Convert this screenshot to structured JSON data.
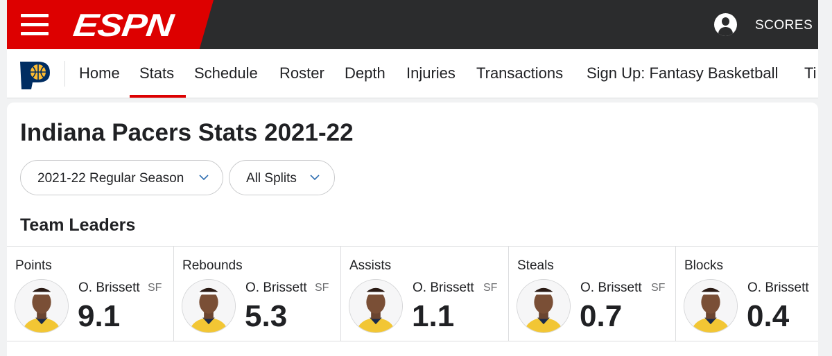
{
  "header": {
    "logo_text": "ESPN",
    "scores_label": "SCORES"
  },
  "team_nav": {
    "items": [
      {
        "label": "Home"
      },
      {
        "label": "Stats"
      },
      {
        "label": "Schedule"
      },
      {
        "label": "Roster"
      },
      {
        "label": "Depth"
      },
      {
        "label": "Injuries"
      },
      {
        "label": "Transactions"
      },
      {
        "label": "Sign Up: Fantasy Basketball"
      },
      {
        "label": "Ti"
      }
    ],
    "active": "Stats"
  },
  "main": {
    "title": "Indiana Pacers Stats 2021-22",
    "filters": [
      {
        "selected": "2021-22 Regular Season"
      },
      {
        "selected": "All Splits"
      }
    ],
    "leaders_title": "Team Leaders",
    "leaders": [
      {
        "category": "Points",
        "player": "O. Brissett",
        "position": "SF",
        "value": "9.1"
      },
      {
        "category": "Rebounds",
        "player": "O. Brissett",
        "position": "SF",
        "value": "5.3"
      },
      {
        "category": "Assists",
        "player": "O. Brissett",
        "position": "SF",
        "value": "1.1"
      },
      {
        "category": "Steals",
        "player": "O. Brissett",
        "position": "SF",
        "value": "0.7"
      },
      {
        "category": "Blocks",
        "player": "O. Brissett",
        "position": "",
        "value": "0.4"
      }
    ]
  },
  "colors": {
    "espn_red": "#dd0000",
    "topbar_dark": "#2b2c2d",
    "pacers_navy": "#002d62",
    "pacers_gold": "#fdbb30",
    "dropdown_chevron": "#2b6cb0"
  }
}
